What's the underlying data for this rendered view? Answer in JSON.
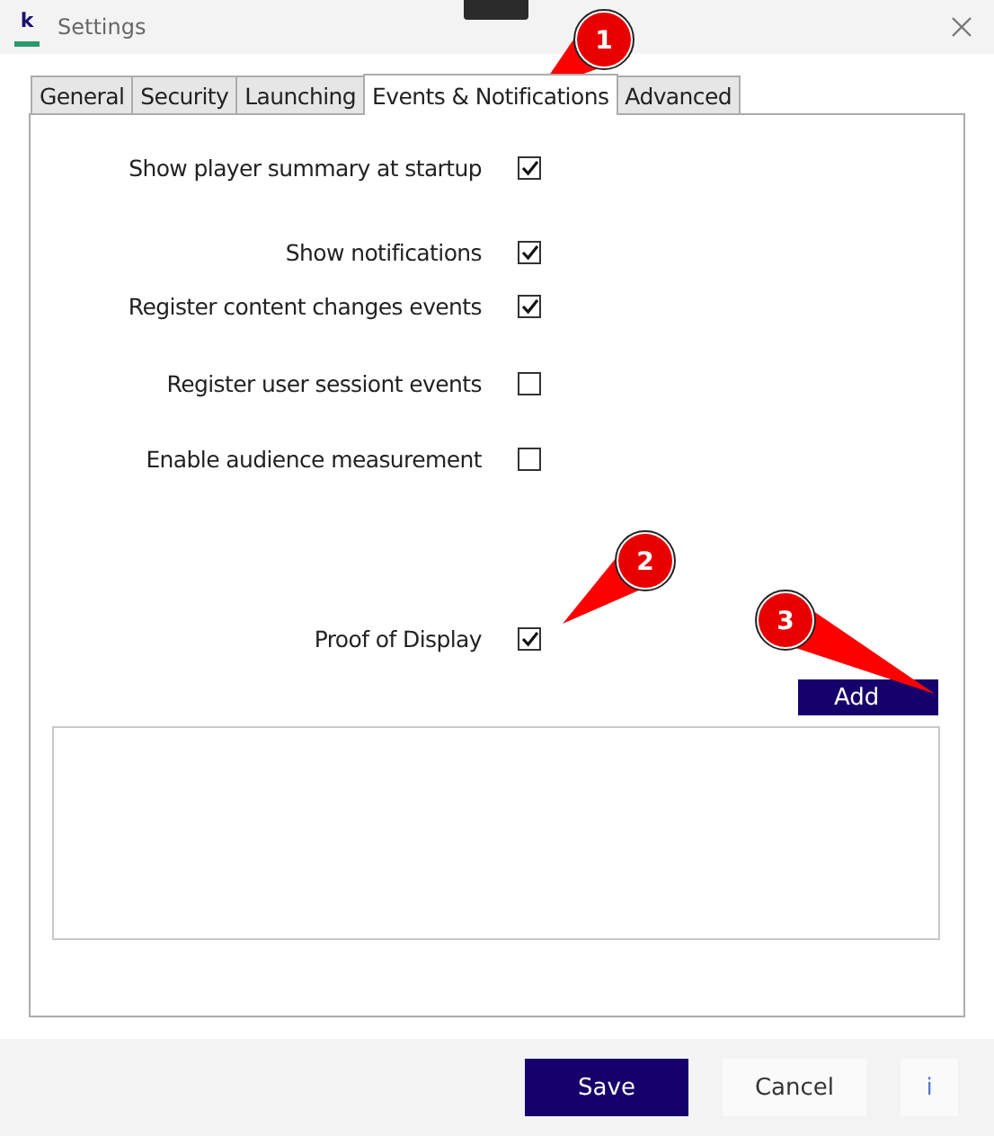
{
  "window": {
    "title": "Settings",
    "icon_letter": "k"
  },
  "tabs": [
    {
      "label": "General",
      "selected": false
    },
    {
      "label": "Security",
      "selected": false
    },
    {
      "label": "Launching",
      "selected": false
    },
    {
      "label": "Events & Notifications",
      "selected": true
    },
    {
      "label": "Advanced",
      "selected": false
    }
  ],
  "options": [
    {
      "label": "Show player summary at startup",
      "checked": true
    },
    {
      "label": "Show notifications",
      "checked": true
    },
    {
      "label": "Register content changes events",
      "checked": true
    },
    {
      "label": "Register user sessiont events",
      "checked": false
    },
    {
      "label": "Enable audience measurement",
      "checked": false
    },
    {
      "label": "Proof of Display",
      "checked": true
    }
  ],
  "add_button": "Add",
  "footer": {
    "buttons": [
      {
        "label": "Save",
        "kind": "primary"
      },
      {
        "label": "Cancel",
        "kind": "secondary"
      },
      {
        "label": "i",
        "kind": "info"
      }
    ]
  },
  "callouts": [
    {
      "number": "1"
    },
    {
      "number": "2"
    },
    {
      "number": "3"
    }
  ]
}
